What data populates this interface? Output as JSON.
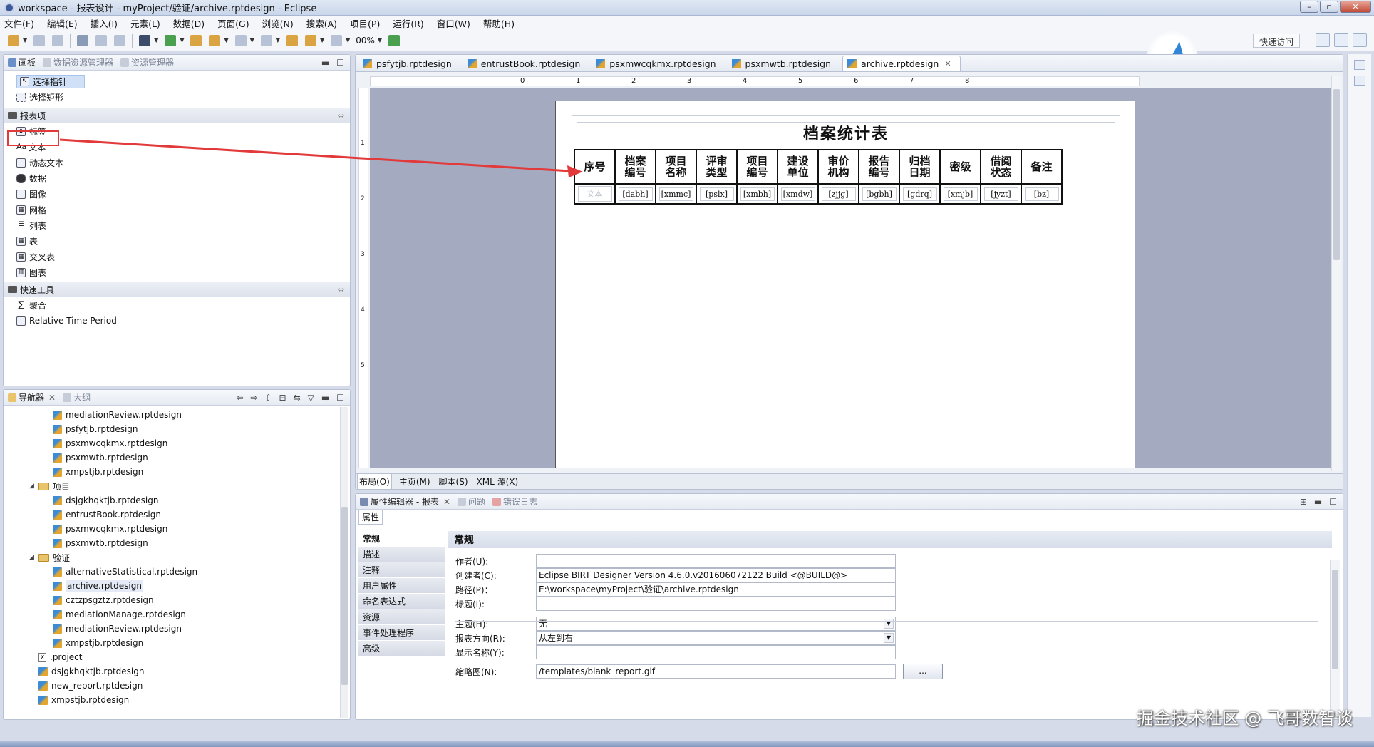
{
  "window": {
    "title": "workspace - 报表设计 - myProject/验证/archive.rptdesign - Eclipse",
    "buttons": {
      "min": "–",
      "max": "▫",
      "close": "✕"
    }
  },
  "menu": [
    "文件(F)",
    "编辑(E)",
    "插入(I)",
    "元素(L)",
    "数据(D)",
    "页面(G)",
    "浏览(N)",
    "搜索(A)",
    "项目(P)",
    "运行(R)",
    "窗口(W)",
    "帮助(H)"
  ],
  "toolbar": {
    "zoom": "00%",
    "quick_access": "快速访问"
  },
  "palette": {
    "tabs": [
      "画板",
      "数据资源管理器",
      "资源管理器"
    ],
    "tools": [
      "选择指针",
      "选择矩形"
    ],
    "report_items_header": "报表项",
    "report_items": [
      {
        "label": "标签",
        "icon": "tag-icon"
      },
      {
        "label": "文本",
        "icon": "text-icon",
        "glyph": "Aa"
      },
      {
        "label": "动态文本",
        "icon": "dynamic-text-icon"
      },
      {
        "label": "数据",
        "icon": "data-icon"
      },
      {
        "label": "图像",
        "icon": "image-icon"
      },
      {
        "label": "网格",
        "icon": "grid-icon"
      },
      {
        "label": "列表",
        "icon": "list-icon"
      },
      {
        "label": "表",
        "icon": "table-icon"
      },
      {
        "label": "交叉表",
        "icon": "crosstab-icon"
      },
      {
        "label": "图表",
        "icon": "chart-icon"
      }
    ],
    "quick_tools_header": "快速工具",
    "quick_tools": [
      {
        "label": "聚合",
        "glyph": "∑"
      },
      {
        "label": "Relative Time Period",
        "glyph": ""
      }
    ]
  },
  "navigator": {
    "tabs": [
      "导航器",
      "大纲"
    ],
    "items": [
      {
        "indent": 3,
        "type": "file",
        "label": "mediationReview.rptdesign"
      },
      {
        "indent": 3,
        "type": "file",
        "label": "psfytjb.rptdesign"
      },
      {
        "indent": 3,
        "type": "file",
        "label": "psxmwcqkmx.rptdesign"
      },
      {
        "indent": 3,
        "type": "file",
        "label": "psxmwtb.rptdesign"
      },
      {
        "indent": 3,
        "type": "file",
        "label": "xmpstjb.rptdesign"
      },
      {
        "indent": 2,
        "type": "folder",
        "label": "项目",
        "open": true
      },
      {
        "indent": 3,
        "type": "file",
        "label": "dsjgkhqktjb.rptdesign"
      },
      {
        "indent": 3,
        "type": "file",
        "label": "entrustBook.rptdesign"
      },
      {
        "indent": 3,
        "type": "file",
        "label": "psxmwcqkmx.rptdesign"
      },
      {
        "indent": 3,
        "type": "file",
        "label": "psxmwtb.rptdesign"
      },
      {
        "indent": 2,
        "type": "folder",
        "label": "验证",
        "open": true
      },
      {
        "indent": 3,
        "type": "file",
        "label": "alternativeStatistical.rptdesign"
      },
      {
        "indent": 3,
        "type": "file",
        "label": "archive.rptdesign",
        "selected": true
      },
      {
        "indent": 3,
        "type": "file",
        "label": "cztzpsgztz.rptdesign"
      },
      {
        "indent": 3,
        "type": "file",
        "label": "mediationManage.rptdesign"
      },
      {
        "indent": 3,
        "type": "file",
        "label": "mediationReview.rptdesign"
      },
      {
        "indent": 3,
        "type": "file",
        "label": "xmpstjb.rptdesign"
      },
      {
        "indent": 2,
        "type": "xfile",
        "label": ".project"
      },
      {
        "indent": 2,
        "type": "file",
        "label": "dsjgkhqktjb.rptdesign"
      },
      {
        "indent": 2,
        "type": "file",
        "label": "new_report.rptdesign"
      },
      {
        "indent": 2,
        "type": "file",
        "label": "xmpstjb.rptdesign"
      }
    ]
  },
  "editor": {
    "tabs": [
      "psfytjb.rptdesign",
      "entrustBook.rptdesign",
      "psxmwcqkmx.rptdesign",
      "psxmwtb.rptdesign",
      "archive.rptdesign"
    ],
    "active_tab": 4,
    "report_title": "档案统计表",
    "columns": [
      "序号",
      "档案\n编号",
      "项目\n名称",
      "评审\n类型",
      "项目\n编号",
      "建设\n单位",
      "审价\n机构",
      "报告\n编号",
      "归档\n日期",
      "密级",
      "借阅\n状态",
      "备注"
    ],
    "cells": [
      "文本",
      "[dabh]",
      "[xmmc]",
      "[pslx]",
      "[xmbh]",
      "[xmdw]",
      "[zjjg]",
      "[bgbh]",
      "[gdrq]",
      "[xmjb]",
      "[jyzt]",
      "[bz]"
    ],
    "bottom_tabs": [
      "布局(O)",
      "主页(M)",
      "脚本(S)",
      "XML 源(X)"
    ]
  },
  "properties": {
    "tabs": [
      "属性编辑器 - 报表",
      "问题",
      "错误日志"
    ],
    "subtab": "属性",
    "categories": [
      "常规",
      "描述",
      "注释",
      "用户属性",
      "命名表达式",
      "资源",
      "事件处理程序",
      "高级"
    ],
    "header": "常规",
    "fields": [
      {
        "label": "作者(U):",
        "value": ""
      },
      {
        "label": "创建者(C):",
        "value": "Eclipse BIRT Designer Version 4.6.0.v201606072122 Build <@BUILD@>"
      },
      {
        "label": "路径(P)：",
        "value": "E:\\workspace\\myProject\\验证\\archive.rptdesign"
      },
      {
        "label": "标题(I):",
        "value": ""
      },
      {
        "label": "主题(H):",
        "value": "无"
      },
      {
        "label": "报表方向(R):",
        "value": "从左到右"
      },
      {
        "label": "显示名称(Y):",
        "value": ""
      },
      {
        "label": "缩略图(N):",
        "value": "/templates/blank_report.gif"
      }
    ],
    "browse_button": "..."
  },
  "watermark": "掘金技术社区 @ 飞哥数智谈",
  "colors": {
    "annotation_red": "#e23a3a",
    "canvas_bg": "#a4aac0",
    "selection": "#cfe0f7"
  }
}
